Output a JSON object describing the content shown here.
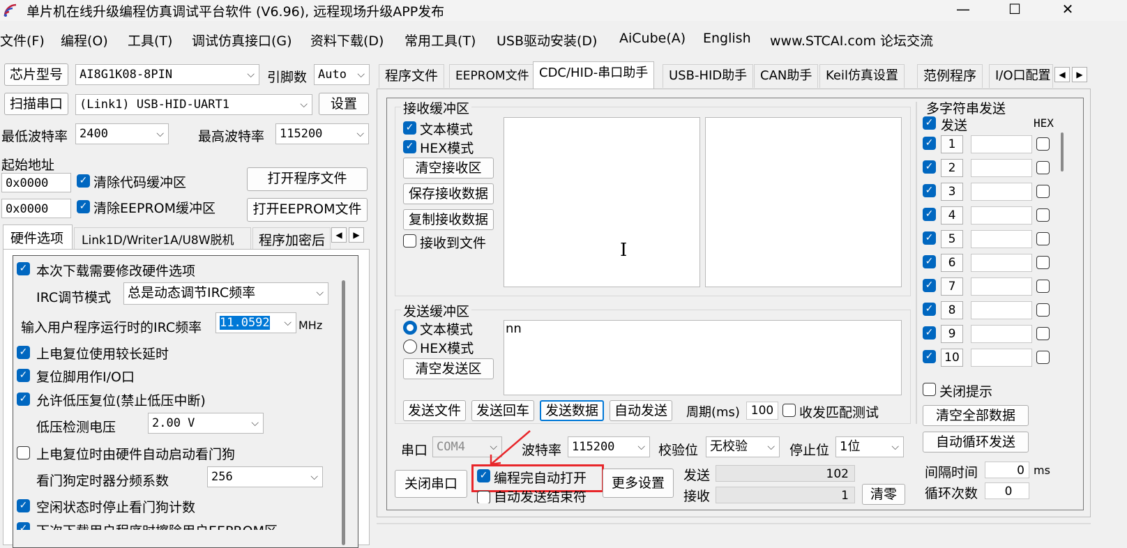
{
  "window": {
    "title": "单片机在线升级编程仿真调试平台软件 (V6.96), 远程现场升级APP发布",
    "minimize": "—",
    "maximize": "☐",
    "close": "✕"
  },
  "menu": [
    "文件(F)",
    "编程(O)",
    "工具(T)",
    "调试仿真接口(G)",
    "资料下载(D)",
    "常用工具(T)",
    "USB驱动安装(D)",
    "AiCube(A)",
    "English",
    "www.STCAI.com 论坛交流"
  ],
  "left": {
    "chip_label": "芯片型号",
    "chip_value": "AI8G1K08-8PIN",
    "pins_label": "引脚数",
    "pins_value": "Auto",
    "scan_button": "扫描串口",
    "port_value": "(Link1) USB-HID-UART1",
    "settings_button": "设置",
    "min_baud_label": "最低波特率",
    "min_baud_value": "2400",
    "max_baud_label": "最高波特率",
    "max_baud_value": "115200",
    "start_addr_label": "起始地址",
    "addr1_value": "0x0000",
    "clear_code_label": "清除代码缓冲区",
    "open_program_button": "打开程序文件",
    "addr2_value": "0x0000",
    "clear_eeprom_label": "清除EEPROM缓冲区",
    "open_eeprom_button": "打开EEPROM文件",
    "tabs": [
      "硬件选项",
      "Link1D/Writer1A/U8W脱机",
      "程序加密后"
    ],
    "hw": {
      "modify_hw_label": "本次下载需要修改硬件选项",
      "irc_mode_label": "IRC调节模式",
      "irc_mode_value": "总是动态调节IRC频率",
      "irc_freq_label": "输入用户程序运行时的IRC频率",
      "irc_freq_value": "11.0592",
      "irc_freq_unit": "MHz",
      "long_delay_label": "上电复位使用较长延时",
      "reset_io_label": "复位脚用作I/O口",
      "lvr_label": "允许低压复位(禁止低压中断)",
      "lvd_label": "低压检测电压",
      "lvd_value": "2.00 V",
      "wdt_label": "上电复位时由硬件自动启动看门狗",
      "wdt_div_label": "看门狗定时器分频系数",
      "wdt_div_value": "256",
      "idle_wdt_label": "空闲状态时停止看门狗计数",
      "next_label": "下次下载用户程序时擦除用户EEPROM区"
    }
  },
  "right": {
    "tabs": [
      "程序文件",
      "EEPROM文件",
      "CDC/HID-串口助手",
      "USB-HID助手",
      "CAN助手",
      "Keil仿真设置",
      "范例程序",
      "I/O口配置"
    ],
    "receive": {
      "group_label": "接收缓冲区",
      "text_mode": "文本模式",
      "hex_mode": "HEX模式",
      "clear_button": "清空接收区",
      "save_button": "保存接收数据",
      "copy_button": "复制接收数据",
      "to_file": "接收到文件",
      "cursor": "I"
    },
    "send": {
      "group_label": "发送缓冲区",
      "text_mode": "文本模式",
      "hex_mode": "HEX模式",
      "clear_button": "清空发送区",
      "content": "nn",
      "send_file": "发送文件",
      "send_cr": "发送回车",
      "send_data": "发送数据",
      "auto_send": "自动发送",
      "period_label": "周期(ms)",
      "period_value": "100",
      "match_test": "收发匹配测试"
    },
    "port": {
      "port_label": "串口",
      "port_value": "COM4",
      "baud_label": "波特率",
      "baud_value": "115200",
      "parity_label": "校验位",
      "parity_value": "无校验",
      "stop_label": "停止位",
      "stop_value": "1位",
      "close_button": "关闭串口",
      "auto_open": "编程完自动打开",
      "auto_send_end": "自动发送结束符",
      "more_settings": "更多设置",
      "send_label": "发送",
      "send_count": "102",
      "recv_label": "接收",
      "recv_count": "1",
      "clear_count": "清零"
    },
    "multi": {
      "group_label": "多字符串发送",
      "send_header": "发送",
      "hex_header": "HEX",
      "rows": [
        "1",
        "2",
        "3",
        "4",
        "5",
        "6",
        "7",
        "8",
        "9",
        "10"
      ],
      "close_tip": "关闭提示",
      "clear_all": "清空全部数据",
      "auto_loop": "自动循环发送",
      "interval_label": "间隔时间",
      "interval_value": "0",
      "interval_unit": "ms",
      "loop_label": "循环次数",
      "loop_value": "0"
    }
  },
  "colors": {
    "accent": "#0067c0",
    "annotation": "#e8262a",
    "highlight": "#0078d7"
  }
}
